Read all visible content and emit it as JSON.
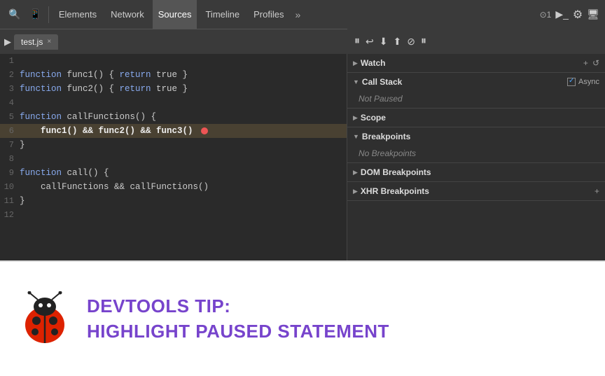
{
  "toolbar": {
    "tabs": [
      "Elements",
      "Network",
      "Sources",
      "Timeline",
      "Profiles"
    ],
    "active_tab": "Sources",
    "icons": {
      "search": "🔍",
      "mobile": "📱",
      "more": "»",
      "counter": "1",
      "terminal": "▶_",
      "settings": "⚙",
      "display": "🖥"
    }
  },
  "file_tab": {
    "name": "test.js",
    "close": "×"
  },
  "code": {
    "lines": [
      {
        "num": 1,
        "content": ""
      },
      {
        "num": 2,
        "content": "function func1() { return true }"
      },
      {
        "num": 3,
        "content": "function func2() { return true }"
      },
      {
        "num": 4,
        "content": ""
      },
      {
        "num": 5,
        "content": "function callFunctions() {"
      },
      {
        "num": 6,
        "content": "    func1() && func2() && func3()",
        "highlight": true,
        "error": true
      },
      {
        "num": 7,
        "content": "}"
      },
      {
        "num": 8,
        "content": ""
      },
      {
        "num": 9,
        "content": "function call() {"
      },
      {
        "num": 10,
        "content": "    callFunctions && callFunctions()"
      },
      {
        "num": 11,
        "content": "}"
      },
      {
        "num": 12,
        "content": ""
      }
    ]
  },
  "right_panel": {
    "sections": [
      {
        "id": "watch",
        "title": "Watch",
        "collapsed": false,
        "actions": [
          "+",
          "↺"
        ]
      },
      {
        "id": "call_stack",
        "title": "Call Stack",
        "collapsed": false,
        "async_label": "Async",
        "status": "Not Paused"
      },
      {
        "id": "scope",
        "title": "Scope",
        "collapsed": true
      },
      {
        "id": "breakpoints",
        "title": "Breakpoints",
        "collapsed": false,
        "status": "No Breakpoints"
      },
      {
        "id": "dom_breakpoints",
        "title": "DOM Breakpoints",
        "collapsed": true
      },
      {
        "id": "xhr_breakpoints",
        "title": "XHR Breakpoints",
        "collapsed": true
      }
    ]
  },
  "second_toolbar": {
    "play_icon": "▶",
    "step_icons": [
      "⏩",
      "⬇",
      "⬆",
      "🚫",
      "⏸"
    ],
    "file_icons": [
      "▶|",
      "Br"
    ]
  },
  "tip": {
    "title_line1": "DevTools Tip:",
    "title_line2": "Highlight Paused Statement"
  }
}
